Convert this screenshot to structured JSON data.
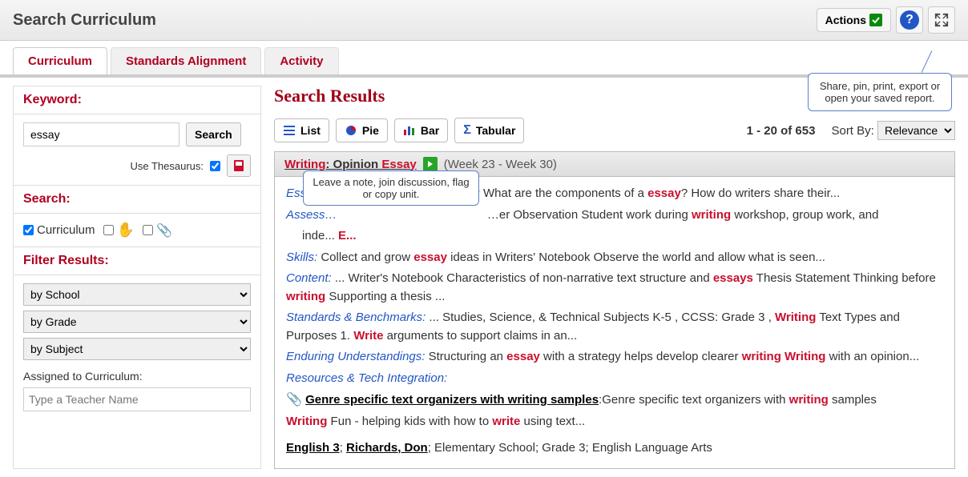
{
  "header": {
    "title": "Search Curriculum",
    "actions_label": "Actions",
    "tooltip": "Share, pin, print, export or open your saved report."
  },
  "tabs": {
    "curriculum": "Curriculum",
    "standards": "Standards Alignment",
    "activity": "Activity"
  },
  "sidebar": {
    "keyword_head": "Keyword:",
    "keyword_value": "essay",
    "search_btn": "Search",
    "thesaurus_label": "Use Thesaurus:",
    "search_head": "Search:",
    "scope_curriculum": "Curriculum",
    "filter_head": "Filter Results:",
    "by_school": "by School",
    "by_grade": "by Grade",
    "by_subject": "by Subject",
    "assigned_label": "Assigned to Curriculum:",
    "teacher_placeholder": "Type a Teacher Name"
  },
  "results": {
    "title": "Search Results",
    "view_list": "List",
    "view_pie": "Pie",
    "view_bar": "Bar",
    "view_tab": "Tabular",
    "count": "1 - 20 of 653",
    "sortby_label": "Sort By:",
    "sortby_value": "Relevance",
    "note_bubble": "Leave a note, join discussion, flag or copy unit.",
    "item": {
      "title_pre": "Writing",
      "title_mid": ": Opinion ",
      "title_kw": "Essay",
      "weeks": "(Week 23 - Week 30)",
      "eq_label": "Essential Questions",
      "eq_text1": "? What are the components of a ",
      "eq_text2": "? How do writers share their...",
      "assess_label": "Assess…",
      "assess_text1": "…er Observation Student work during ",
      "assess_text2": " workshop, group work, and",
      "assess_line2a": "inde...",
      "assess_line2b": "E...",
      "skills_label": "Skills:",
      "skills_text1": "  Collect and grow ",
      "skills_text2": " ideas in Writers' Notebook Observe the world and allow what is seen...",
      "content_label": "Content:",
      "content_text1": " ... Writer's Notebook Characteristics of non-narrative text structure and ",
      "content_text2": " Thesis Statement Thinking before ",
      "content_text3": " Supporting a thesis ...",
      "sb_label": "Standards & Benchmarks:",
      "sb_text1": " ... Studies, Science, & Technical Subjects K-5 , CCSS: Grade 3 , ",
      "sb_text2": " Text Types and Purposes 1. ",
      "sb_text3": " arguments to support claims in an...",
      "eu_label": "Enduring Understandings:",
      "eu_text1": "  Structuring an ",
      "eu_text2": " with a strategy helps develop clearer ",
      "eu_text3": " with an opinion...",
      "rti_label": "Resources & Tech Integration:",
      "genre_link": "Genre specific text organizers with writing samples",
      "genre_text1": ":Genre specific text organizers with ",
      "genre_text2": " samples",
      "wf_text1": " Fun - helping kids with how to ",
      "wf_text2": " using text...",
      "footer_course": "English 3",
      "footer_sep": "; ",
      "footer_teacher": "Richards, Don",
      "footer_rest": "; Elementary School; Grade 3; English Language Arts",
      "kw_essay": "essay",
      "kw_essays": "essays",
      "kw_writing": "writing",
      "kw_Writing": "Writing",
      "kw_Write": "Write",
      "kw_write": "write"
    }
  }
}
